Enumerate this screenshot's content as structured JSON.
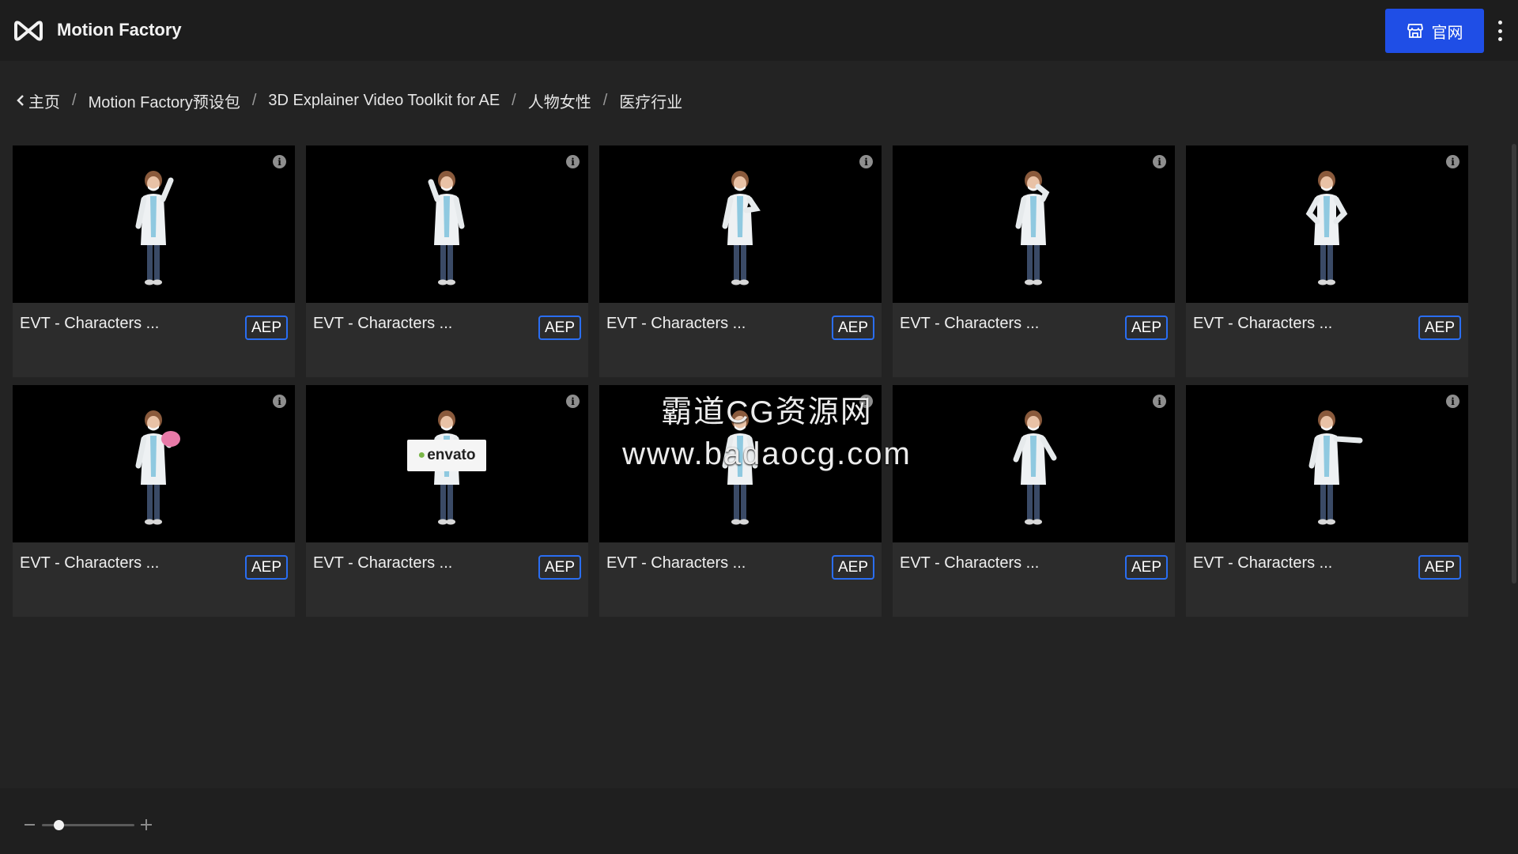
{
  "header": {
    "app_title": "Motion Factory",
    "logo_icon": "infinity-m-logo-icon",
    "site_button_label": "官网",
    "site_button_icon": "storefront-icon",
    "menu_icon": "more-vertical-icon",
    "accent_color": "#1f4ee6"
  },
  "breadcrumb": {
    "back_icon": "chevron-left-icon",
    "items": [
      "主页",
      "Motion Factory预设包",
      "3D Explainer Video Toolkit for AE",
      "人物女性",
      "医疗行业"
    ],
    "separator": "/"
  },
  "cards": [
    {
      "title": "EVT - Characters ...",
      "badge": "AEP",
      "pose": "wave"
    },
    {
      "title": "EVT - Characters ...",
      "badge": "AEP",
      "pose": "raise-hand"
    },
    {
      "title": "EVT - Characters ...",
      "badge": "AEP",
      "pose": "thumbs-up"
    },
    {
      "title": "EVT - Characters ...",
      "badge": "AEP",
      "pose": "magnifier"
    },
    {
      "title": "EVT - Characters ...",
      "badge": "AEP",
      "pose": "hands-on-hips"
    },
    {
      "title": "EVT - Characters ...",
      "badge": "AEP",
      "pose": "piggy-bank"
    },
    {
      "title": "EVT - Characters ...",
      "badge": "AEP",
      "pose": "holding-sign",
      "sign_text": "envato"
    },
    {
      "title": "EVT - Characters ...",
      "badge": "AEP",
      "pose": "standing"
    },
    {
      "title": "EVT - Characters ...",
      "badge": "AEP",
      "pose": "walking"
    },
    {
      "title": "EVT - Characters ...",
      "badge": "AEP",
      "pose": "pointing"
    }
  ],
  "badge_color": "#2a6ef2",
  "watermark": {
    "line1": "霸道CG资源网",
    "line2": "www.badaocg.com"
  },
  "zoom": {
    "minus_icon": "minus-icon",
    "plus_icon": "plus-icon",
    "level_fraction": 0.18
  }
}
